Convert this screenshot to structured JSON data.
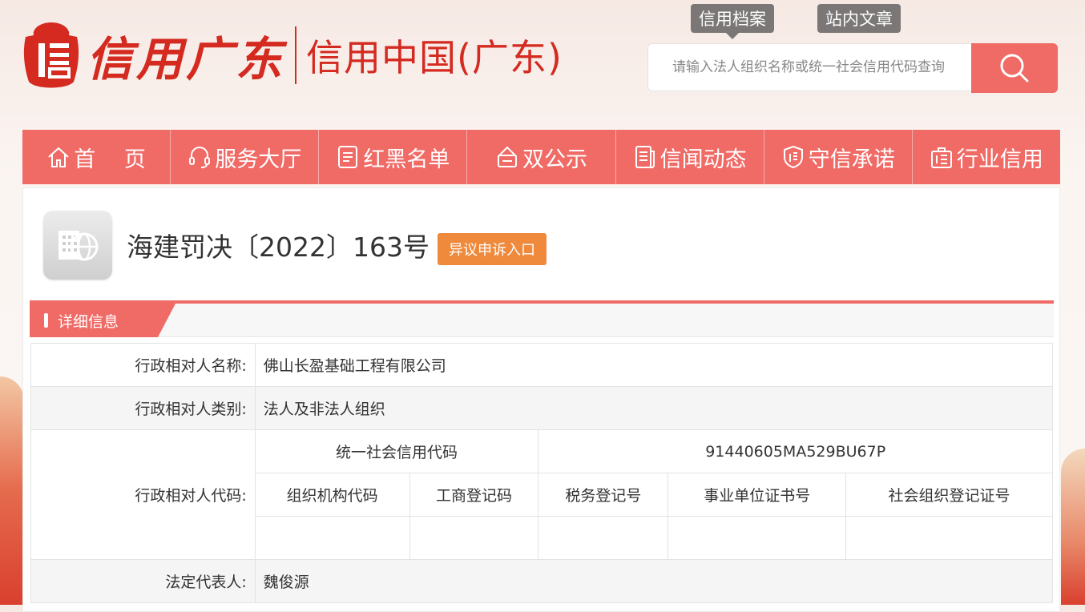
{
  "header": {
    "logo_script": "信用广东",
    "logo_sub": "信用中国(广东)",
    "top_tabs": [
      "信用档案",
      "站内文章"
    ],
    "search_placeholder": "请输入法人组织名称或统一社会信用代码查询"
  },
  "nav": {
    "items": [
      {
        "label": "首　 页",
        "icon": "home-icon"
      },
      {
        "label": "服务大厅",
        "icon": "headset-icon"
      },
      {
        "label": "红黑名单",
        "icon": "list-icon"
      },
      {
        "label": "双公示",
        "icon": "bell-sign-icon"
      },
      {
        "label": "信闻动态",
        "icon": "news-icon"
      },
      {
        "label": "守信承诺",
        "icon": "shield-icon"
      },
      {
        "label": "行业信用",
        "icon": "building-icon"
      }
    ]
  },
  "main": {
    "title": "海建罚决〔2022〕163号",
    "appeal_button": "异议申诉入口",
    "section_tab": "详细信息",
    "rows": {
      "name_label": "行政相对人名称:",
      "name_value": "佛山长盈基础工程有限公司",
      "category_label": "行政相对人类别:",
      "category_value": "法人及非法人组织",
      "code_label": "行政相对人代码:",
      "uscc_label": "统一社会信用代码",
      "uscc_value": "91440605MA529BU67P",
      "code_headers": [
        "组织机构代码",
        "工商登记码",
        "税务登记号",
        "事业单位证书号",
        "社会组织登记证号"
      ],
      "legal_rep_label": "法定代表人:",
      "legal_rep_value": "魏俊源"
    }
  },
  "colors": {
    "brand_red": "#d42a20",
    "nav_bg": "#f06a66",
    "appeal_orange": "#ef8a3c"
  }
}
